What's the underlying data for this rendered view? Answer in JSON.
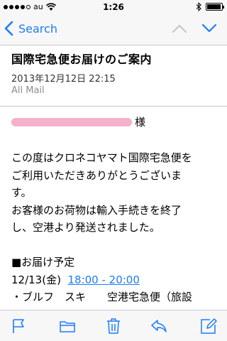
{
  "status_bar": {
    "carrier": "au",
    "time": "1:26",
    "battery_level": 0.95,
    "signal_dots_filled": 4,
    "signal_dots_total": 5
  },
  "nav": {
    "back_label": "Search",
    "back_icon": "chevron-left-icon",
    "prev_icon": "chevron-up-icon",
    "next_icon": "chevron-down-icon",
    "accent_color": "#1a7cf9"
  },
  "message": {
    "subject": "国際宅急便お届けのご案内",
    "date": "2013年12月12日 22:15",
    "folder": "All Mail",
    "addressee_suffix": "様",
    "paragraph1": [
      "この度はクロネコヤマト国際宅急便を",
      "ご利用いただきありがとうございま",
      "す。",
      "お客様のお荷物は輸入手続きを終了",
      "し、空港より発送されました。"
    ],
    "section_title": "■お届け予定",
    "delivery_date": "12/13(金)",
    "delivery_time": "18:00 - 20:00",
    "cut_line": "・ブルフ　スキ　　空港宅急便（旅設"
  },
  "toolbar": {
    "flag_icon": "flag-icon",
    "folder_icon": "folder-icon",
    "trash_icon": "trash-icon",
    "reply_icon": "reply-icon",
    "compose_icon": "compose-icon"
  }
}
